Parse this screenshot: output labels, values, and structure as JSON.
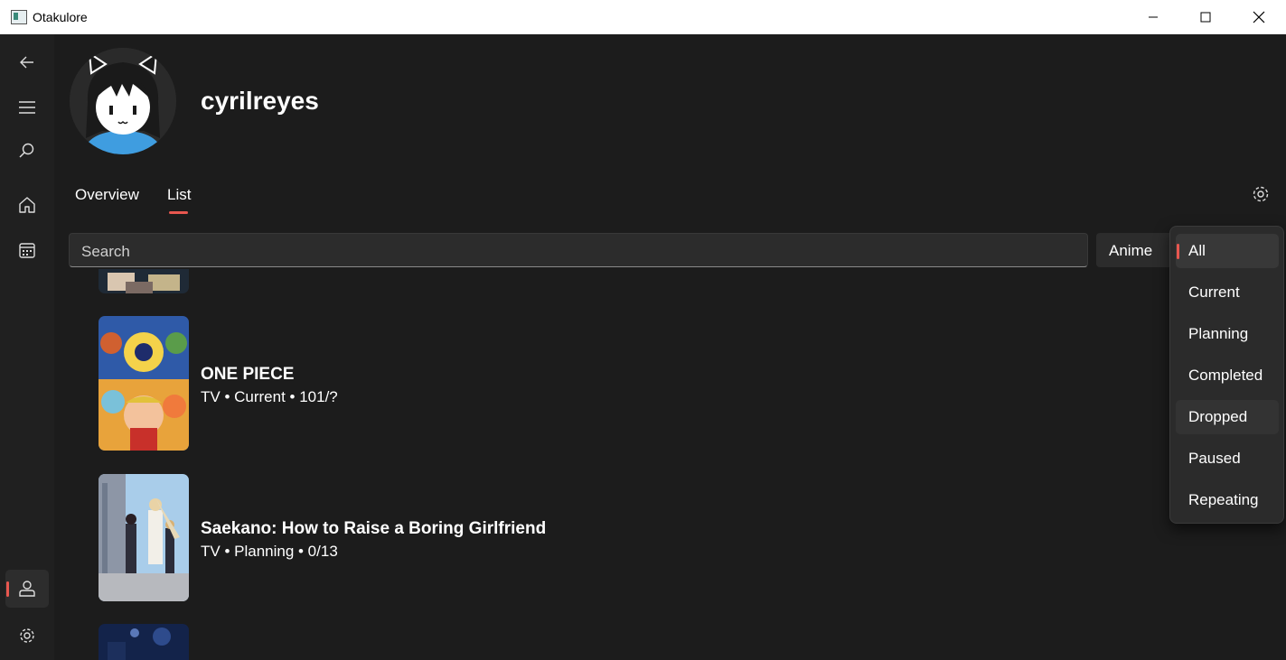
{
  "window": {
    "title": "Otakulore"
  },
  "profile": {
    "username": "cyrilreyes"
  },
  "tabs": [
    {
      "label": "Overview"
    },
    {
      "label": "List"
    }
  ],
  "search": {
    "placeholder": "Search"
  },
  "media_type": {
    "selected": "Anime"
  },
  "list_items": [
    {
      "title": "ONE PIECE",
      "meta": "TV • Current • 101/?"
    },
    {
      "title": "Saekano: How to Raise a Boring Girlfriend",
      "meta": "TV • Planning • 0/13"
    }
  ],
  "status_filter": {
    "options": [
      "All",
      "Current",
      "Planning",
      "Completed",
      "Dropped",
      "Paused",
      "Repeating"
    ],
    "selected": "All"
  },
  "colors": {
    "accent": "#e8574f",
    "background": "#1c1c1c"
  }
}
